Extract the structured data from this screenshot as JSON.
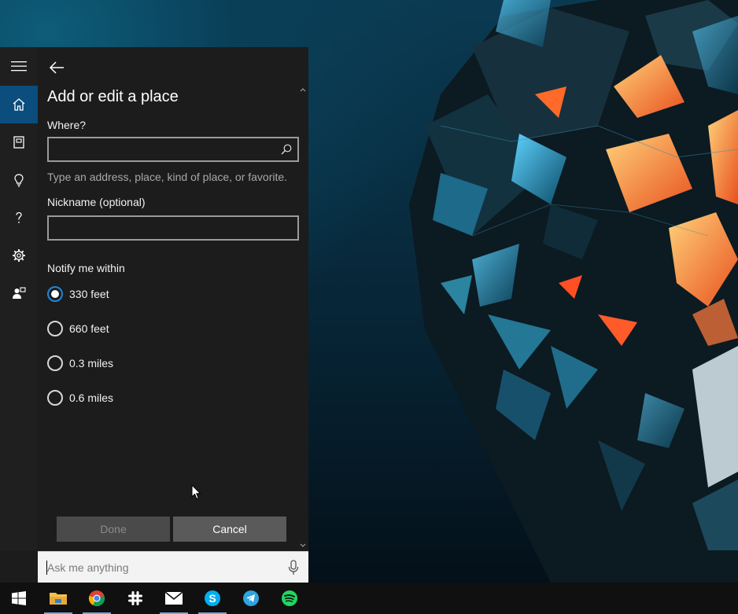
{
  "panel": {
    "title": "Add or edit a place",
    "where_label": "Where?",
    "where_value": "",
    "where_hint": "Type an address, place, kind of place, or favorite.",
    "nickname_label": "Nickname (optional)",
    "nickname_value": "",
    "notify_label": "Notify me within",
    "radius_options": [
      {
        "label": "330 feet",
        "checked": true
      },
      {
        "label": "660 feet",
        "checked": false
      },
      {
        "label": "0.3 miles",
        "checked": false
      },
      {
        "label": "0.6 miles",
        "checked": false
      }
    ],
    "done_label": "Done",
    "cancel_label": "Cancel"
  },
  "rail": {
    "items": [
      {
        "icon": "hamburger-menu-icon"
      },
      {
        "icon": "home-icon",
        "active": true
      },
      {
        "icon": "notebook-icon"
      },
      {
        "icon": "lightbulb-icon"
      },
      {
        "icon": "help-icon"
      },
      {
        "icon": "gear-icon"
      },
      {
        "icon": "feedback-icon"
      }
    ]
  },
  "search": {
    "placeholder": "Ask me anything",
    "mic_icon": "microphone-icon"
  },
  "taskbar": {
    "items": [
      {
        "icon": "windows-start-icon"
      },
      {
        "icon": "file-explorer-icon",
        "running": true
      },
      {
        "icon": "chrome-icon",
        "running": true
      },
      {
        "icon": "slack-icon"
      },
      {
        "icon": "mail-icon",
        "running": true
      },
      {
        "icon": "skype-icon",
        "running": true
      },
      {
        "icon": "telegram-icon"
      },
      {
        "icon": "spotify-icon"
      }
    ]
  },
  "colors": {
    "accent": "#0b4d7c",
    "radio_selected": "#1e86d9",
    "panel_bg": "#1c1c1c"
  }
}
